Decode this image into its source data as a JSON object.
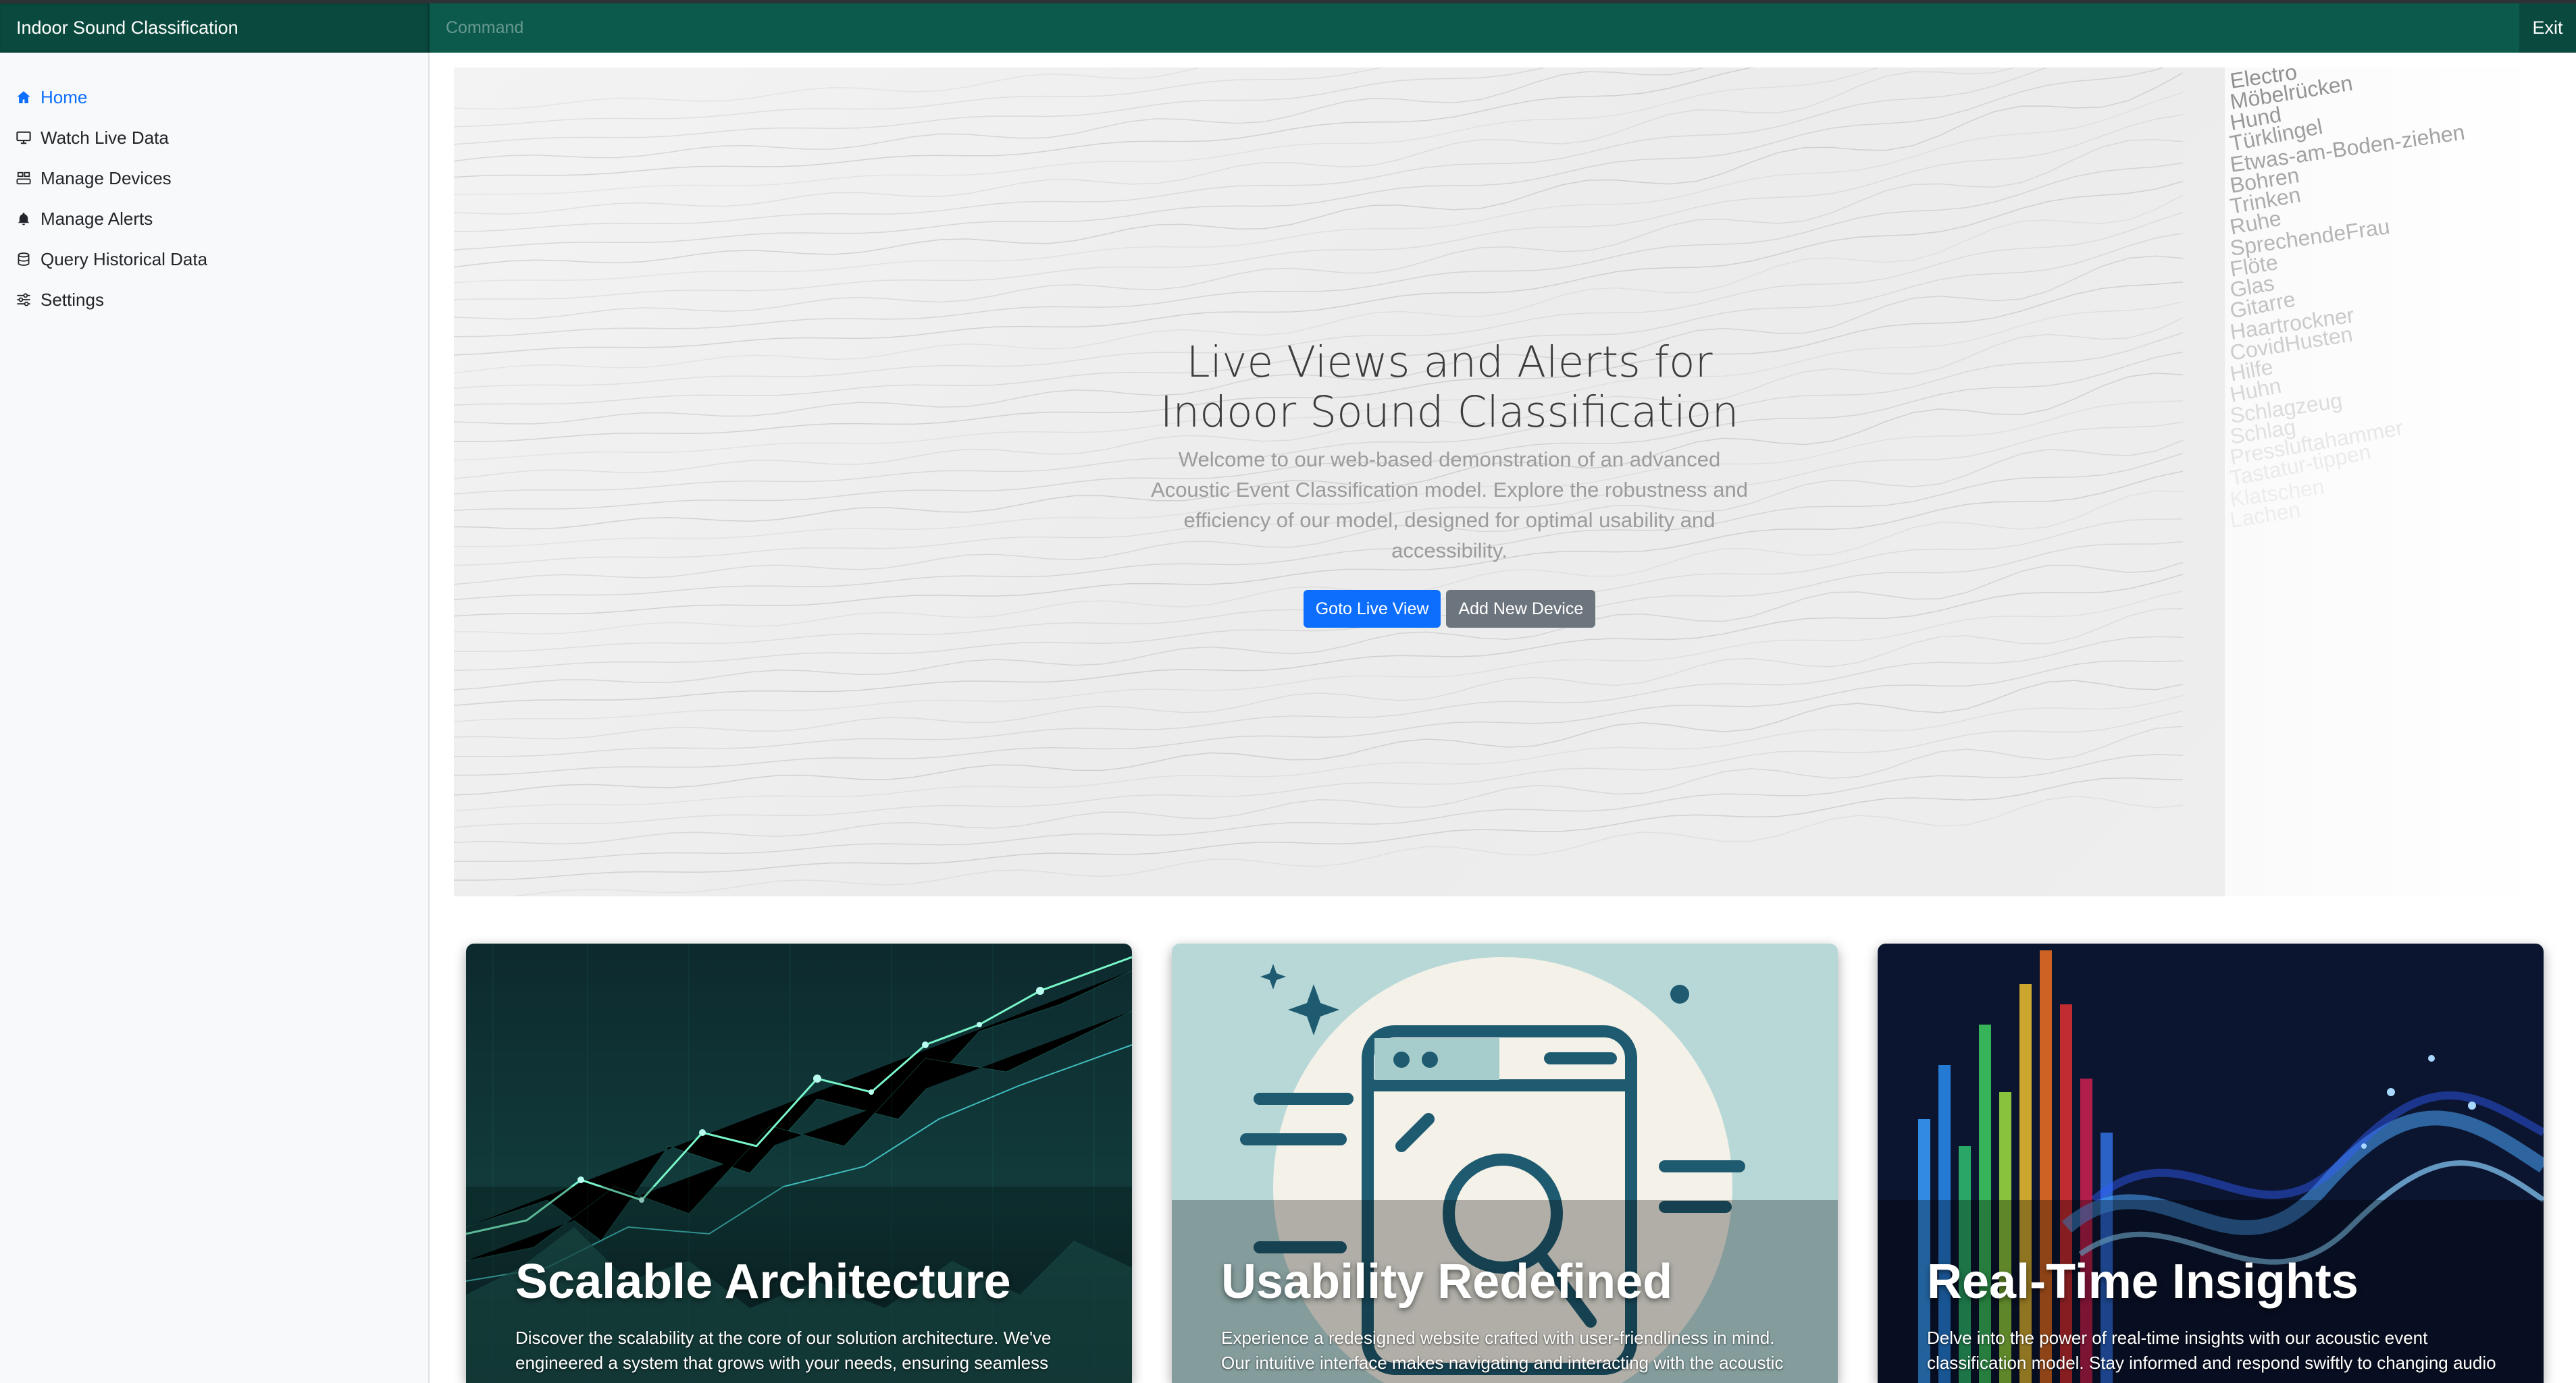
{
  "app": {
    "title": "Indoor Sound Classification",
    "command_placeholder": "Command",
    "exit_label": "Exit"
  },
  "sidebar": {
    "items": [
      {
        "label": "Home",
        "icon": "house-icon",
        "active": true
      },
      {
        "label": "Watch Live Data",
        "icon": "monitor-icon",
        "active": false
      },
      {
        "label": "Manage Devices",
        "icon": "devices-icon",
        "active": false
      },
      {
        "label": "Manage Alerts",
        "icon": "bell-icon",
        "active": false
      },
      {
        "label": "Query Historical Data",
        "icon": "database-icon",
        "active": false
      },
      {
        "label": "Settings",
        "icon": "sliders-icon",
        "active": false
      }
    ]
  },
  "hero": {
    "title_line1": "Live Views and Alerts for",
    "title_line2": "Indoor Sound Classification",
    "text": "Welcome to our web-based demonstration of an advanced Acoustic Event Classification model. Explore the robustness and efficiency of our model, designed for optimal usability and accessibility.",
    "primary_button": "Goto Live View",
    "secondary_button": "Add New Device",
    "sound_words": [
      "Electro",
      "Möbelrücken",
      "Hund",
      "Türklingel",
      "Etwas-am-Boden-ziehen",
      "Bohren",
      "Trinken",
      "Ruhe",
      "SprechendeFrau",
      "Flöte",
      "Glas",
      "Gitarre",
      "Haartrockner",
      "CovidHusten",
      "Hilfe",
      "Huhn",
      "Schlagzeug",
      "Schlag",
      "Pressluftahammer",
      "Tastatur-tippen",
      "Klatschen",
      "Lachen"
    ]
  },
  "cards": [
    {
      "title": "Scalable Architecture",
      "text": "Discover the scalability at the core of our solution architecture. We've engineered a system that grows with your needs, ensuring seamless"
    },
    {
      "title": "Usability Redefined",
      "text": "Experience a redesigned website crafted with user-friendliness in mind. Our intuitive interface makes navigating and interacting with the acoustic"
    },
    {
      "title": "Real-Time Insights",
      "text": "Delve into the power of real-time insights with our acoustic event classification model. Stay informed and respond swiftly to changing audio"
    }
  ],
  "colors": {
    "topbar": "#0c5a4b",
    "brand_bg": "#0a4a3e",
    "primary": "#0d6efd",
    "secondary": "#6c757d",
    "sidebar_bg": "#f8f9fa"
  }
}
